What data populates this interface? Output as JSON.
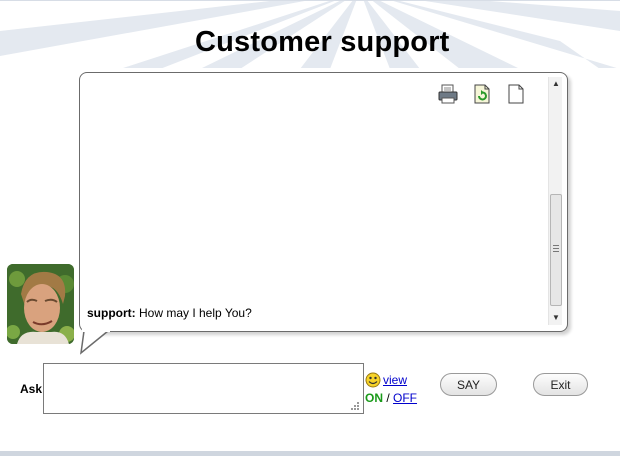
{
  "header": {
    "title": "Customer support"
  },
  "toolbar": {
    "icons": [
      "print-icon",
      "refresh-icon",
      "new-page-icon"
    ]
  },
  "chat": {
    "messages": [
      {
        "sender": "support:",
        "text": "How may I help You?"
      }
    ]
  },
  "input": {
    "label": "Ask",
    "value": ""
  },
  "smileys": {
    "link": "view",
    "on": "ON",
    "separator": " / ",
    "off": "OFF"
  },
  "buttons": {
    "say": "SAY",
    "exit": "Exit"
  },
  "colors": {
    "on_green": "#1a9a1a",
    "link_blue": "#0000cc"
  }
}
